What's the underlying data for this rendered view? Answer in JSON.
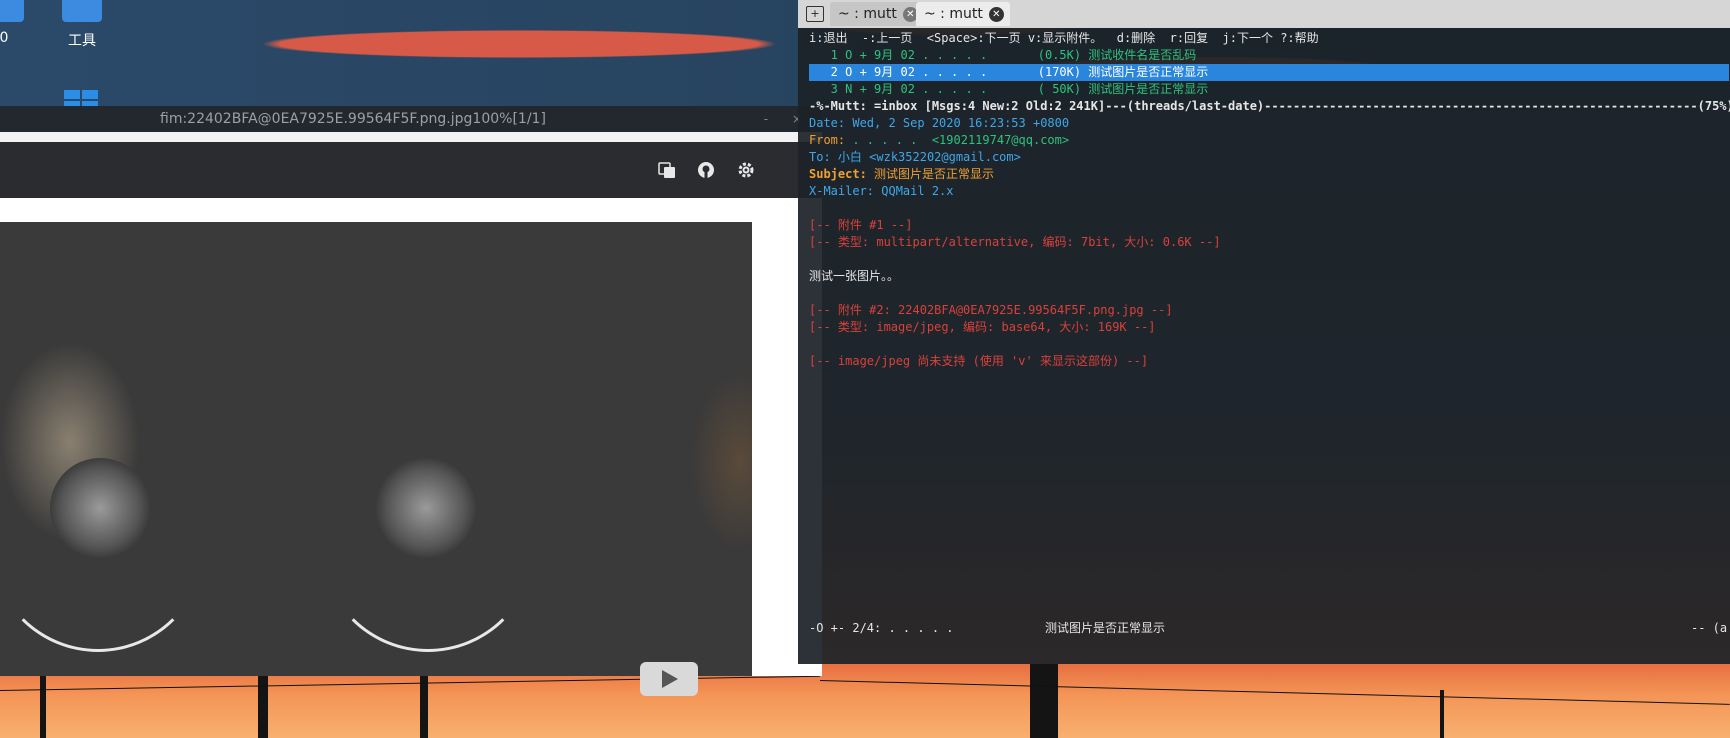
{
  "desktop": {
    "icon_left_label": "0",
    "icon_tools_label": "工具"
  },
  "viewer": {
    "title": "fim:22402BFA@0EA7925E.99564F5F.png.jpg100%[1/1]",
    "controls": "- ×"
  },
  "terminal": {
    "tabs": [
      {
        "label": "~ : mutt"
      },
      {
        "label": "~ : mutt"
      }
    ],
    "help_bar": "i:退出  -:上一页  <Space>:下一页 v:显示附件。  d:删除  r:回复  j:下一个 ?:帮助",
    "messages": [
      {
        "line": "   1 O + 9月 02 . . . . .       (0.5K) 测试收件名是否乱码"
      },
      {
        "line": "   2 O + 9月 02 . . . . .       (170K) 测试图片是否正常显示"
      },
      {
        "line": "   3 N + 9月 02 . . . . .       ( 50K) 测试图片是否正常显示"
      }
    ],
    "status_bar": "-%-Mutt: =inbox [Msgs:4 New:2 Old:2 241K]---(threads/last-date)------------------------------------------------------------(75%)",
    "headers": {
      "date_key": "Date:",
      "date_val": " Wed, 2 Sep 2020 16:23:53 +0800",
      "from_key": "From:",
      "from_val": " . . . . .  <1902119747@qq.com>",
      "to_key": "To:",
      "to_name": " 小白 ",
      "to_val": "<wzk352202@gmail.com>",
      "subject_key": "Subject:",
      "subject_val": " 测试图片是否正常显示",
      "mailer_key": "X-Mailer:",
      "mailer_val": " QQMail 2.x"
    },
    "body": {
      "att1": "[-- 附件 #1 --]",
      "att1_type": "[-- 类型: multipart/alternative, 编码: 7bit, 大小: 0.6K --]",
      "text": "测试一张图片。。",
      "att2": "[-- 附件 #2: 22402BFA@0EA7925E.99564F5F.png.jpg --]",
      "att2_type": "[-- 类型: image/jpeg, 编码: base64, 大小: 169K --]",
      "unsupported": "[-- image/jpeg 尚未支持 (使用 'v' 来显示这部份) --]"
    },
    "pager_status_left": "-O +- 2/4: . . . . .",
    "pager_status_subject": "测试图片是否正常显示",
    "pager_status_right": "-- (a"
  },
  "colors": {
    "selection": "#2a86dd",
    "green": "#2ec27e",
    "cyan": "#3fa7e8",
    "red": "#d9413a"
  }
}
